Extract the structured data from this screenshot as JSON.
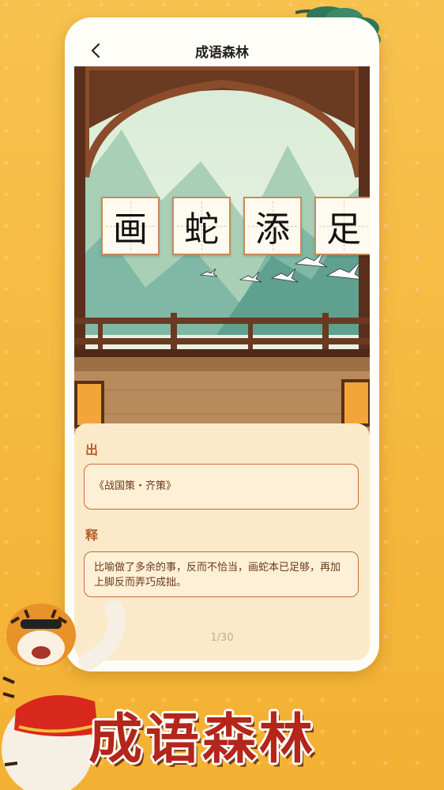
{
  "app": {
    "title": "成语森林"
  },
  "nav": {
    "back_icon": "chevron-left-icon"
  },
  "idiom": {
    "chars": [
      "画",
      "蛇",
      "添",
      "足"
    ]
  },
  "source": {
    "label": "出",
    "text": "《战国策・齐策》"
  },
  "meaning": {
    "label": "释",
    "text": "比喻做了多余的事，反而不恰当，画蛇本已足够，再加上脚反而弄巧成拙。"
  },
  "pager": {
    "text": "1/30"
  },
  "promo": {
    "title": "成语森林"
  },
  "colors": {
    "accent": "#b4602a",
    "background": "#f5b93f",
    "banner": "#b4251a"
  }
}
